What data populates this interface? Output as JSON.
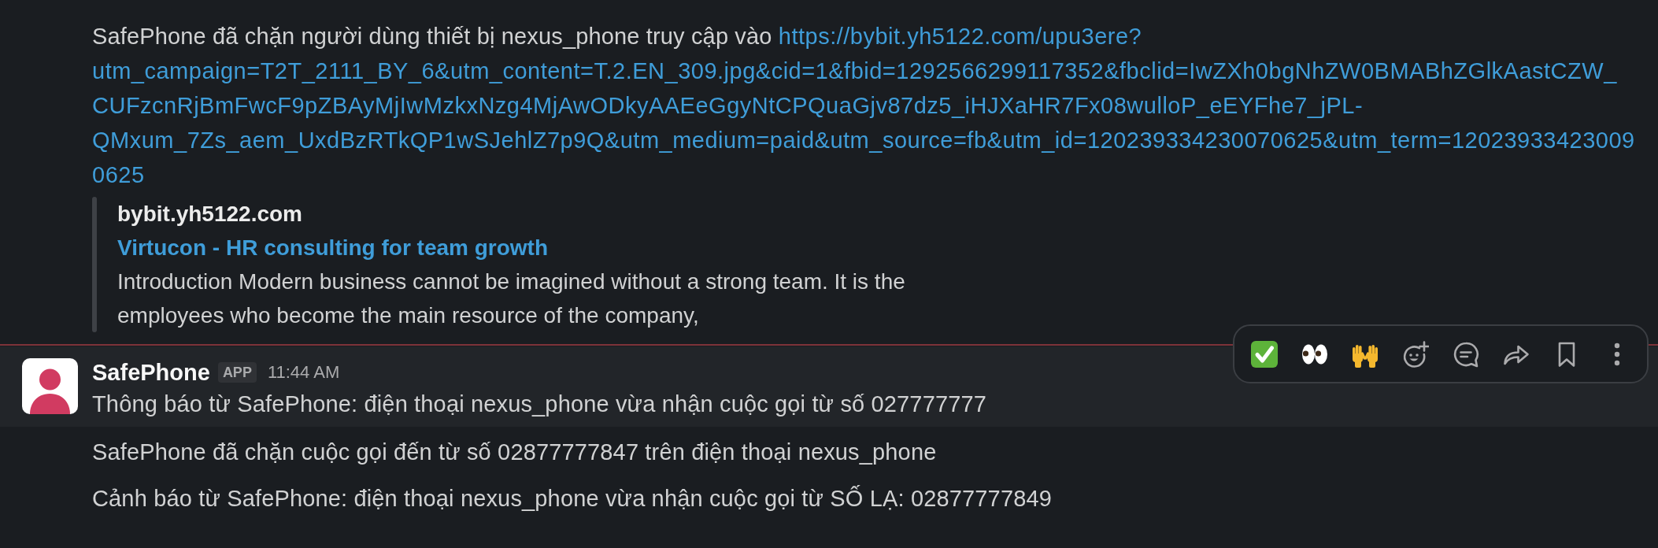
{
  "messages": [
    {
      "text": "SafePhone đã chặn người dùng thiết bị nexus_phone truy cập vào",
      "link_lines": [
        "https://bybit.yh5122.com/upu3ere?",
        "utm_campaign=T2T_2111_BY_6&utm_content=T.2.EN_309.jpg&cid=1&fbid=1292566299117352&fbclid=IwZXh0bgNhZW0BMABhZGlkAastCZW_",
        "CUFzcnRjBmFwcF9pZBAyMjIwMzkxNzg4MjAwODkyAAEeGgyNtCPQuaGjv87dz5_iHJXaHR7Fx08wulloP_eEYFhe7_jPL-",
        "QMxum_7Zs_aem_UxdBzRTkQP1wSJehlZ7p9Q&utm_medium=paid&utm_source=fb&utm_id=120239334230070625&utm_term=12023933423009",
        "0625"
      ],
      "hovered": false,
      "new_divider": false,
      "preview": {
        "site": "bybit.yh5122.com",
        "title": "Virtucon - HR consulting for team growth",
        "description": "Introduction Modern business cannot be imagined without a strong team. It is the employees who become the main resource of the company,"
      }
    },
    {
      "sender": "SafePhone",
      "badge": "APP",
      "time": "11:44 AM",
      "text": "Thông báo từ SafePhone: điện thoại nexus_phone vừa nhận cuộc gọi từ số 027777777",
      "hovered": true,
      "new_divider": true
    },
    {
      "text": "SafePhone đã chặn cuộc gọi đến từ số 02877777847 trên điện thoại nexus_phone",
      "hovered": false,
      "new_divider": false
    },
    {
      "text": "Cảnh báo từ SafePhone: điện thoại nexus_phone vừa nhận cuộc gọi từ SỐ LẠ: 02877777849",
      "hovered": false,
      "new_divider": false
    }
  ]
}
